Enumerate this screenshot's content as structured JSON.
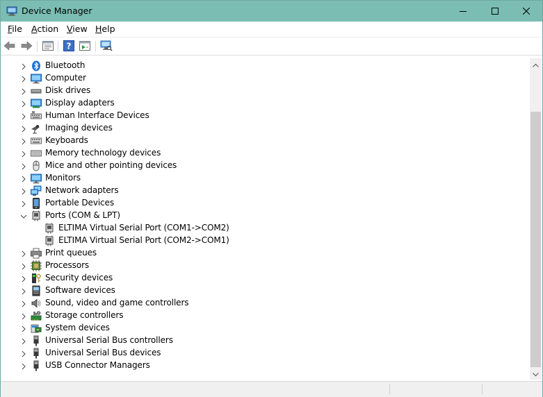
{
  "window": {
    "title": "Device Manager",
    "accent_color": "#7bbdb3"
  },
  "menu": {
    "items": [
      {
        "label": "File",
        "accel": "F",
        "rest": "ile"
      },
      {
        "label": "Action",
        "accel": "A",
        "rest": "ction"
      },
      {
        "label": "View",
        "accel": "V",
        "rest": "iew"
      },
      {
        "label": "Help",
        "accel": "H",
        "rest": "elp"
      }
    ]
  },
  "toolbar": {
    "buttons": [
      "back-arrow-icon",
      "forward-arrow-icon",
      "properties-icon",
      "help-icon",
      "update-driver-icon",
      "scan-hardware-icon"
    ]
  },
  "tree": {
    "items": [
      {
        "label": "Bluetooth",
        "icon": "bluetooth-icon",
        "expanded": false,
        "level": 1
      },
      {
        "label": "Computer",
        "icon": "computer-icon",
        "expanded": false,
        "level": 1
      },
      {
        "label": "Disk drives",
        "icon": "disk-drive-icon",
        "expanded": false,
        "level": 1
      },
      {
        "label": "Display adapters",
        "icon": "display-adapter-icon",
        "expanded": false,
        "level": 1
      },
      {
        "label": "Human Interface Devices",
        "icon": "hid-icon",
        "expanded": false,
        "level": 1
      },
      {
        "label": "Imaging devices",
        "icon": "camera-icon",
        "expanded": false,
        "level": 1
      },
      {
        "label": "Keyboards",
        "icon": "keyboard-icon",
        "expanded": false,
        "level": 1
      },
      {
        "label": "Memory technology devices",
        "icon": "memory-icon",
        "expanded": false,
        "level": 1
      },
      {
        "label": "Mice and other pointing devices",
        "icon": "mouse-icon",
        "expanded": false,
        "level": 1
      },
      {
        "label": "Monitors",
        "icon": "monitor-icon",
        "expanded": false,
        "level": 1
      },
      {
        "label": "Network adapters",
        "icon": "network-icon",
        "expanded": false,
        "level": 1
      },
      {
        "label": "Portable Devices",
        "icon": "portable-device-icon",
        "expanded": false,
        "level": 1
      },
      {
        "label": "Ports (COM & LPT)",
        "icon": "port-icon",
        "expanded": true,
        "level": 1
      },
      {
        "label": "ELTIMA Virtual Serial Port (COM1->COM2)",
        "icon": "port-icon",
        "expanded": null,
        "level": 2
      },
      {
        "label": "ELTIMA Virtual Serial Port (COM2->COM1)",
        "icon": "port-icon",
        "expanded": null,
        "level": 2
      },
      {
        "label": "Print queues",
        "icon": "printer-icon",
        "expanded": false,
        "level": 1
      },
      {
        "label": "Processors",
        "icon": "processor-icon",
        "expanded": false,
        "level": 1
      },
      {
        "label": "Security devices",
        "icon": "security-device-icon",
        "expanded": false,
        "level": 1
      },
      {
        "label": "Software devices",
        "icon": "software-device-icon",
        "expanded": false,
        "level": 1
      },
      {
        "label": "Sound, video and game controllers",
        "icon": "speaker-icon",
        "expanded": false,
        "level": 1
      },
      {
        "label": "Storage controllers",
        "icon": "storage-controller-icon",
        "expanded": false,
        "level": 1
      },
      {
        "label": "System devices",
        "icon": "system-device-icon",
        "expanded": false,
        "level": 1
      },
      {
        "label": "Universal Serial Bus controllers",
        "icon": "usb-icon",
        "expanded": false,
        "level": 1
      },
      {
        "label": "Universal Serial Bus devices",
        "icon": "usb-icon",
        "expanded": false,
        "level": 1
      },
      {
        "label": "USB Connector Managers",
        "icon": "usb-icon",
        "expanded": false,
        "level": 1
      }
    ]
  }
}
